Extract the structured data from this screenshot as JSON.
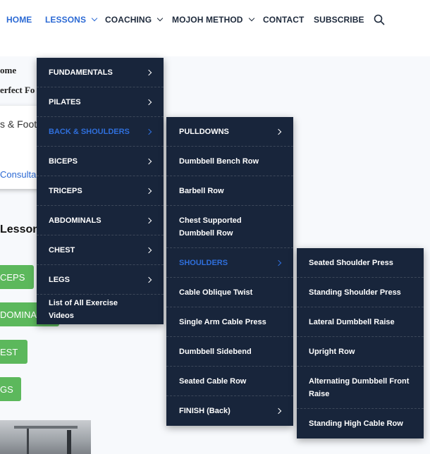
{
  "nav": {
    "items": [
      {
        "label": "HOME",
        "active": true,
        "has_dropdown": false
      },
      {
        "label": "LESSONS",
        "active": false,
        "has_dropdown": true
      },
      {
        "label": "COACHING",
        "active": false,
        "has_dropdown": true
      },
      {
        "label": "MOJOH METHOD",
        "active": false,
        "has_dropdown": true
      },
      {
        "label": "CONTACT",
        "active": false,
        "has_dropdown": false
      },
      {
        "label": "SUBSCRIBE",
        "active": false,
        "has_dropdown": false
      }
    ],
    "search_icon": "search-icon"
  },
  "background": {
    "crumb1": "ome",
    "crumb2": "erfect Fo",
    "card_text": "s & Foot",
    "card_link": "Consulta",
    "lessons_heading": "Lessons",
    "buttons": [
      "CEPS",
      "DOMINAL",
      "EST",
      "GS"
    ]
  },
  "menus": {
    "level1": [
      {
        "label": "FUNDAMENTALS",
        "arrow": true,
        "active": false
      },
      {
        "label": "PILATES",
        "arrow": true,
        "active": false
      },
      {
        "label": "BACK & SHOULDERS",
        "arrow": true,
        "active": true
      },
      {
        "label": "BICEPS",
        "arrow": true,
        "active": false
      },
      {
        "label": "TRICEPS",
        "arrow": true,
        "active": false
      },
      {
        "label": "ABDOMINALS",
        "arrow": true,
        "active": false
      },
      {
        "label": "CHEST",
        "arrow": true,
        "active": false
      },
      {
        "label": "LEGS",
        "arrow": true,
        "active": false
      },
      {
        "label": "List of All Exercise Videos",
        "arrow": false,
        "active": false
      }
    ],
    "level2": [
      {
        "label": "PULLDOWNS",
        "arrow": true,
        "active": false
      },
      {
        "label": "Dumbbell Bench Row",
        "arrow": false,
        "active": false
      },
      {
        "label": "Barbell Row",
        "arrow": false,
        "active": false
      },
      {
        "label": "Chest Supported Dumbbell Row",
        "arrow": false,
        "active": false
      },
      {
        "label": "SHOULDERS",
        "arrow": true,
        "active": true
      },
      {
        "label": "Cable Oblique Twist",
        "arrow": false,
        "active": false
      },
      {
        "label": "Single Arm Cable Press",
        "arrow": false,
        "active": false
      },
      {
        "label": "Dumbbell Sidebend",
        "arrow": false,
        "active": false
      },
      {
        "label": "Seated Cable Row",
        "arrow": false,
        "active": false
      },
      {
        "label": "FINISH (Back)",
        "arrow": true,
        "active": false
      }
    ],
    "level3": [
      {
        "label": "Seated Shoulder Press",
        "arrow": false,
        "active": false
      },
      {
        "label": "Standing Shoulder Press",
        "arrow": false,
        "active": false
      },
      {
        "label": "Lateral Dumbbell Raise",
        "arrow": false,
        "active": false
      },
      {
        "label": "Upright Row",
        "arrow": false,
        "active": false
      },
      {
        "label": "Alternating Dumbbell Front Raise",
        "arrow": false,
        "active": false
      },
      {
        "label": "Standing High Cable Row",
        "arrow": false,
        "active": false
      }
    ]
  },
  "colors": {
    "accent": "#2c6ad4",
    "menu_bg": "#18253b",
    "button_green": "#5cb85c"
  }
}
